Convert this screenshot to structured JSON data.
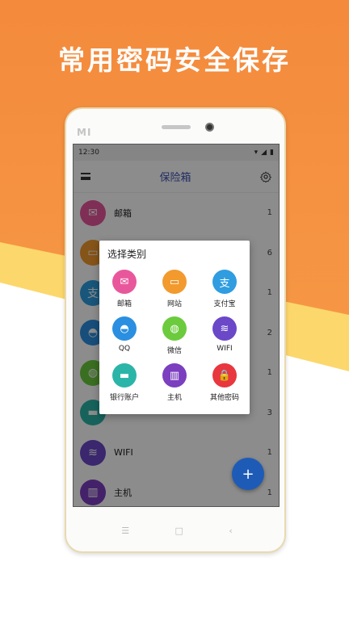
{
  "headline": "常用密码安全保存",
  "phone": {
    "brand": "MI"
  },
  "status_bar": {
    "time": "12:30"
  },
  "app_bar": {
    "title": "保险箱"
  },
  "list": [
    {
      "label": "邮箱",
      "count": "1",
      "color": "#e8579c",
      "icon": "mail-icon"
    },
    {
      "label": "",
      "count": "6",
      "color": "#f29a2e",
      "icon": "monitor-icon"
    },
    {
      "label": "",
      "count": "1",
      "color": "#2f9de0",
      "icon": "alipay-icon"
    },
    {
      "label": "",
      "count": "2",
      "color": "#2a8fe0",
      "icon": "qq-icon"
    },
    {
      "label": "",
      "count": "1",
      "color": "#6bcb3d",
      "icon": "wechat-icon"
    },
    {
      "label": "",
      "count": "3",
      "color": "#2bb5a8",
      "icon": "card-icon"
    },
    {
      "label": "WIFI",
      "count": "1",
      "color": "#6a48c8",
      "icon": "wifi-router-icon"
    },
    {
      "label": "主机",
      "count": "1",
      "color": "#7c3fbf",
      "icon": "server-icon"
    }
  ],
  "dialog": {
    "title": "选择类别",
    "categories": [
      {
        "label": "邮箱",
        "color": "#e8579c",
        "icon": "mail-icon"
      },
      {
        "label": "网站",
        "color": "#f29a2e",
        "icon": "monitor-icon"
      },
      {
        "label": "支付宝",
        "color": "#2f9de0",
        "icon": "alipay-icon"
      },
      {
        "label": "QQ",
        "color": "#2a8fe0",
        "icon": "qq-icon"
      },
      {
        "label": "微信",
        "color": "#6bcb3d",
        "icon": "wechat-icon"
      },
      {
        "label": "WIFI",
        "color": "#6a48c8",
        "icon": "wifi-router-icon"
      },
      {
        "label": "银行账户",
        "color": "#2bb5a8",
        "icon": "card-icon"
      },
      {
        "label": "主机",
        "color": "#7c3fbf",
        "icon": "server-icon"
      },
      {
        "label": "其他密码",
        "color": "#e8373e",
        "icon": "lock-icon"
      }
    ]
  },
  "fab": {
    "label": "+"
  }
}
